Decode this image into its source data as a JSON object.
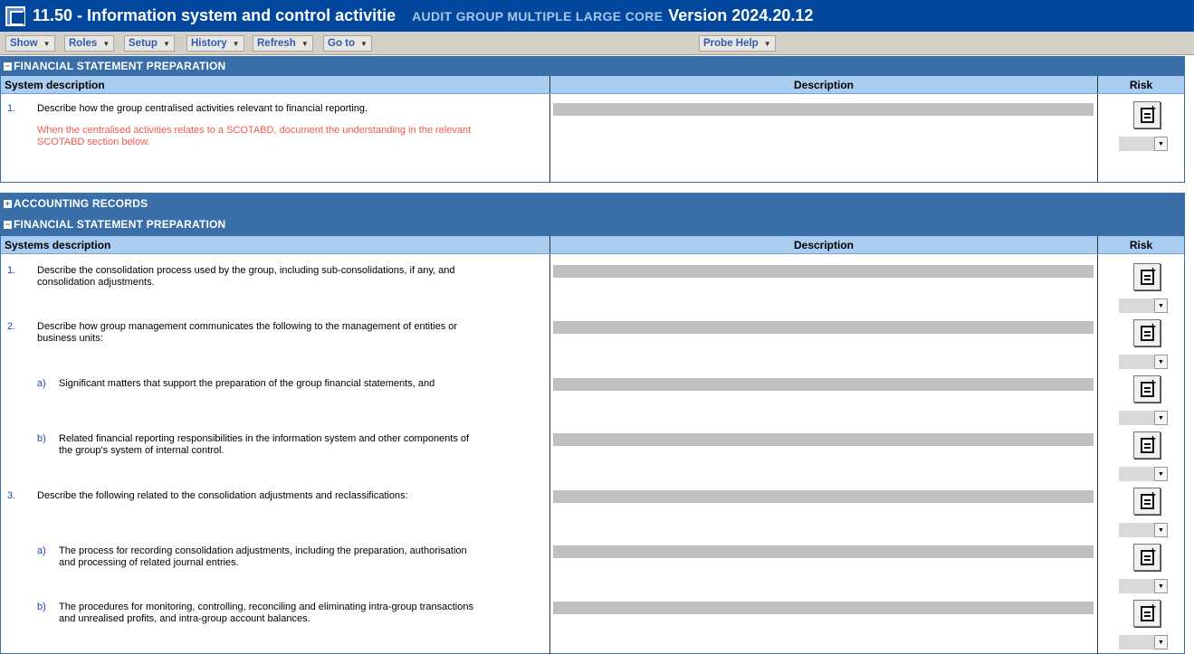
{
  "window": {
    "title": "11.50 - Information system and control activitie",
    "subtitle": "AUDIT GROUP MULTIPLE LARGE CORE",
    "version": "Version 2024.20.12"
  },
  "menu": {
    "show": "Show",
    "roles": "Roles",
    "setup": "Setup",
    "history": "History",
    "refresh": "Refresh",
    "goto": "Go to",
    "probe_help": "Probe Help"
  },
  "section1": {
    "band_title": "FINANCIAL STATEMENT PREPARATION",
    "col1": "System description",
    "col2": "Description",
    "col3": "Risk",
    "q1": {
      "num": "1.",
      "text": "Describe how the group centralised activities relevant to financial reporting.",
      "guidance": "When the centralised activities relates to a SCOTABD, document the understanding in the relevant SCOTABD section below."
    }
  },
  "section2": {
    "band_accounting": "ACCOUNTING RECORDS",
    "band_title": "FINANCIAL STATEMENT PREPARATION",
    "col1": "Systems description",
    "col2": "Description",
    "col3": "Risk",
    "q1": {
      "num": "1.",
      "text": "Describe the consolidation process used by the group, including sub-consolidations, if any, and consolidation adjustments."
    },
    "q2": {
      "num": "2.",
      "text": "Describe how group management communicates the following to the management of entities or business units:"
    },
    "q2a": {
      "letter": "a)",
      "text": "Significant matters that support the preparation of the group financial statements, and"
    },
    "q2b": {
      "letter": "b)",
      "text": "Related financial reporting responsibilities in the information system and other components of the group's system of internal control."
    },
    "q3": {
      "num": "3.",
      "text": "Describe the following related to the consolidation adjustments and reclassifications:"
    },
    "q3a": {
      "letter": "a)",
      "text": "The process for recording consolidation adjustments, including the preparation, authorisation and processing of related journal entries."
    },
    "q3b": {
      "letter": "b)",
      "text": "The procedures for monitoring, controlling, reconciling and eliminating intra-group transactions and unrealised profits, and intra-group account balances."
    }
  },
  "icons": {
    "app": "app-window-icon",
    "collapse": "minus-toggle-icon",
    "expand": "plus-toggle-icon",
    "risk": "add-risk-document-icon",
    "dropdown": "dropdown-arrow-icon"
  },
  "colors": {
    "title_bar": "#00479d",
    "band": "#3a6ea8",
    "column_header": "#a9ccf1",
    "guidance_text": "#f05a4a",
    "question_number": "#2244bb"
  }
}
